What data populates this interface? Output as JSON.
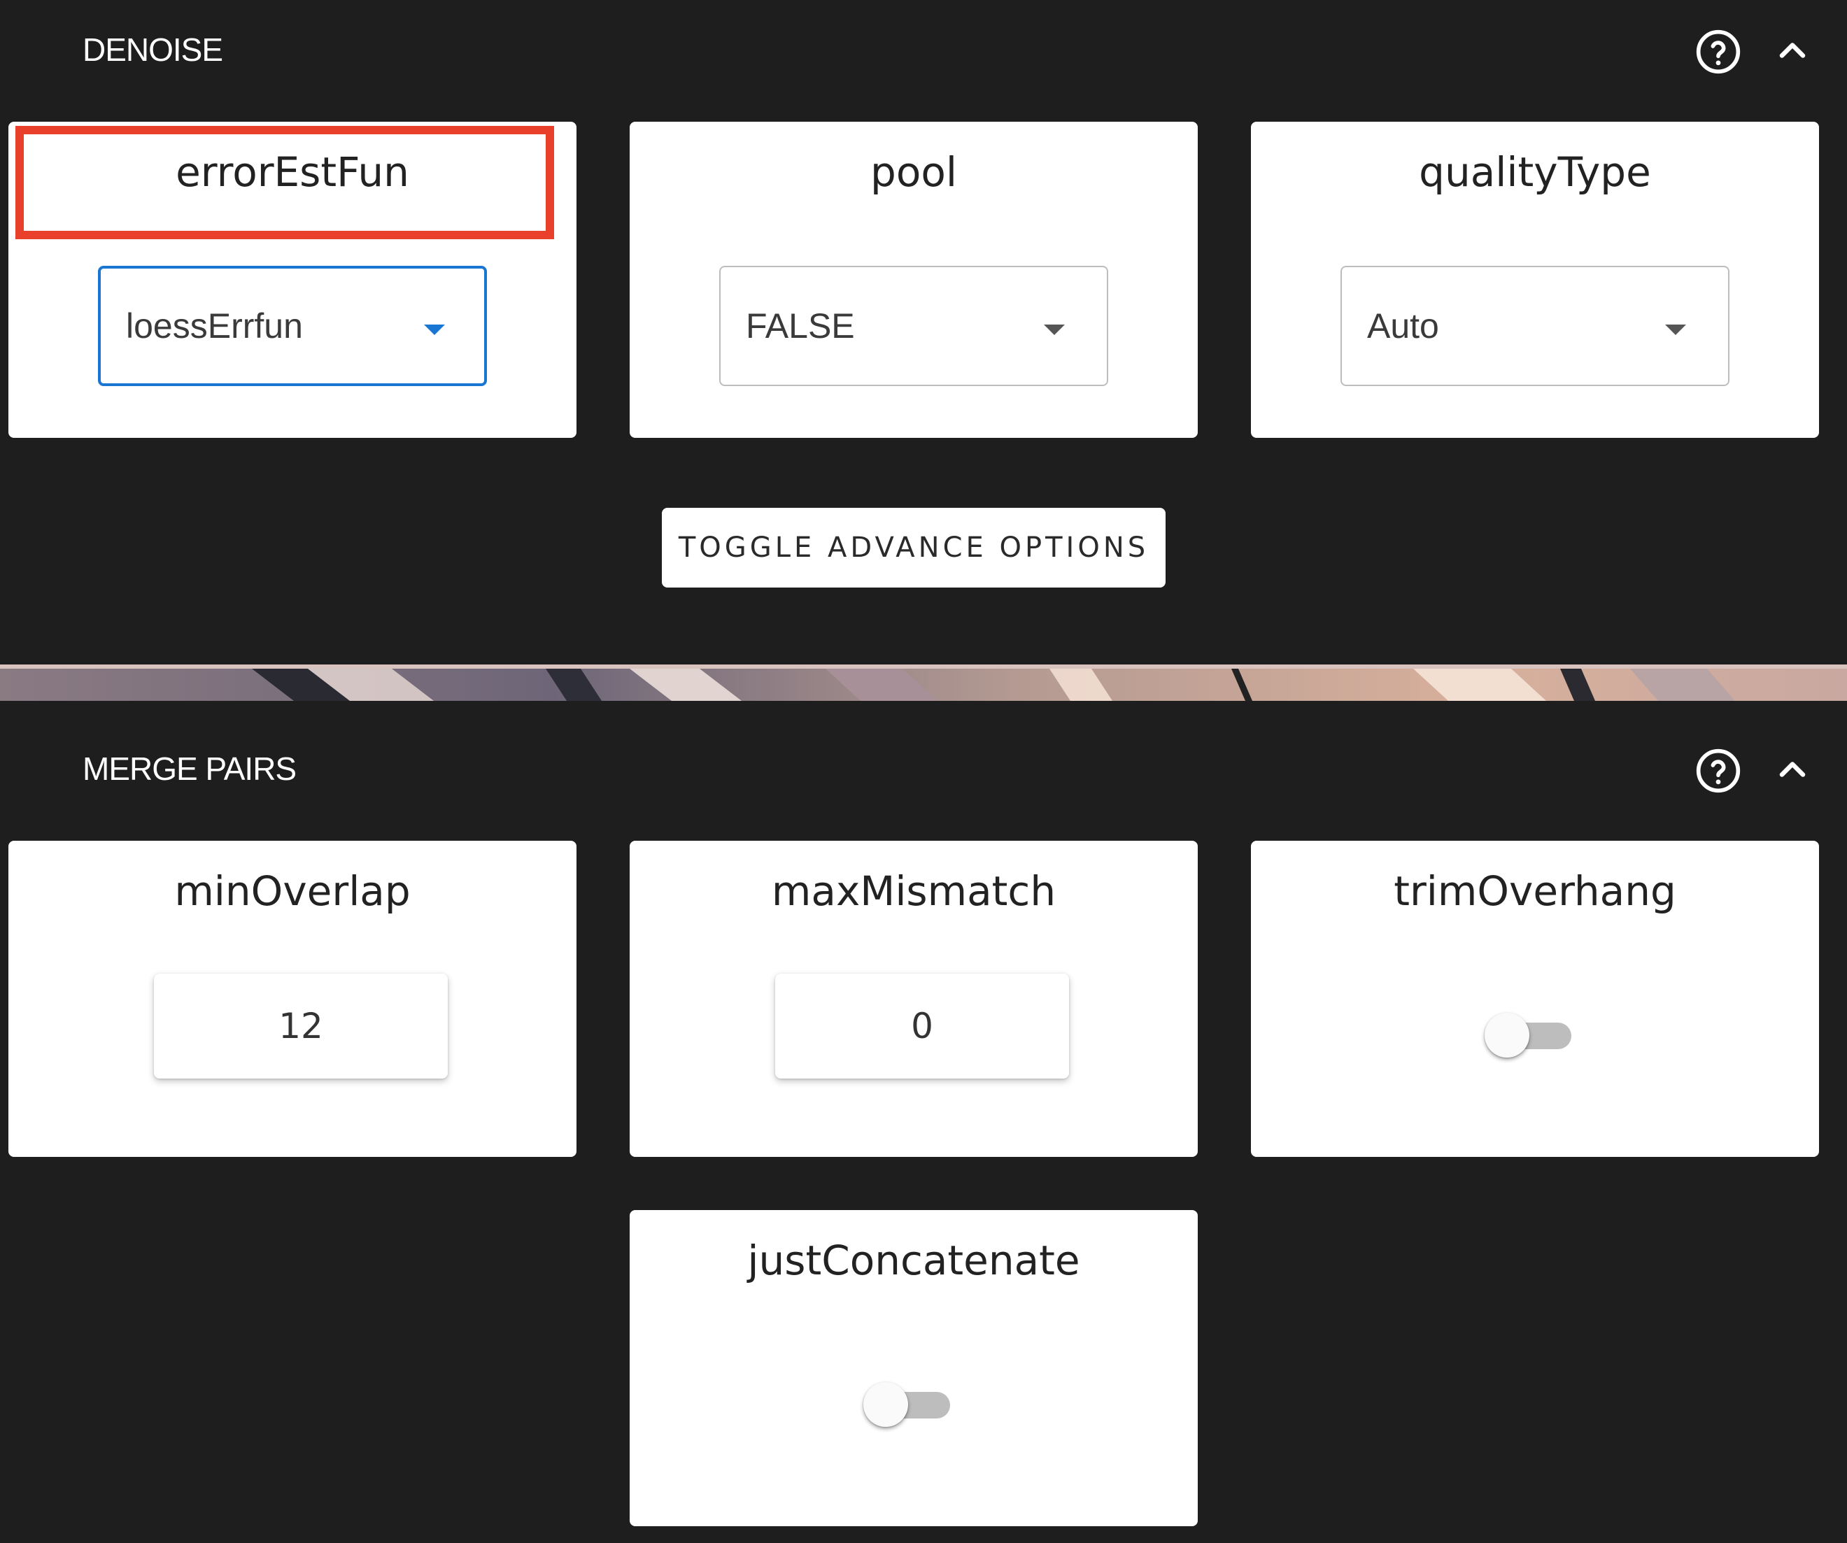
{
  "denoise": {
    "title": "DENOISE",
    "help_icon": "help-circle-icon",
    "collapse_icon": "chevron-up-icon",
    "params": [
      {
        "label": "errorEstFun",
        "value": "loessErrfun",
        "control": "select",
        "focused": true,
        "highlighted": true
      },
      {
        "label": "pool",
        "value": "FALSE",
        "control": "select"
      },
      {
        "label": "qualityType",
        "value": "Auto",
        "control": "select"
      }
    ],
    "toggle_advance_label": "TOGGLE ADVANCE OPTIONS"
  },
  "merge_pairs": {
    "title": "MERGE PAIRS",
    "help_icon": "help-circle-icon",
    "collapse_icon": "chevron-up-icon",
    "params": [
      {
        "label": "minOverlap",
        "value": "12",
        "control": "number"
      },
      {
        "label": "maxMismatch",
        "value": "0",
        "control": "number"
      },
      {
        "label": "trimOverhang",
        "control": "switch",
        "checked": false
      },
      {
        "label": "justConcatenate",
        "control": "switch",
        "checked": false
      }
    ]
  },
  "colors": {
    "background": "#1e1e1e",
    "card": "#ffffff",
    "focus_accent": "#1976d2",
    "highlight": "#e8402a"
  }
}
